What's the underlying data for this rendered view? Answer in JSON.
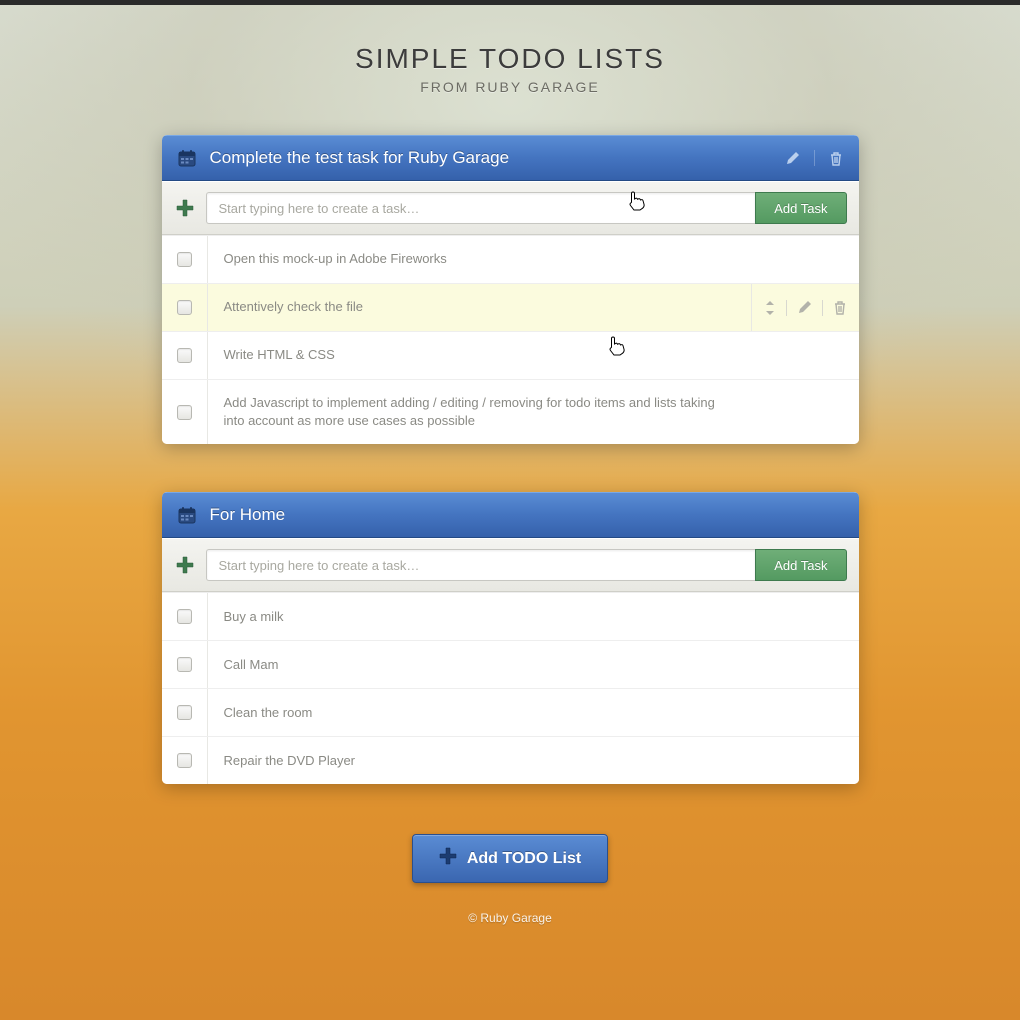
{
  "header": {
    "title": "SIMPLE TODO LISTS",
    "subtitle": "FROM RUBY GARAGE"
  },
  "add_task_button": "Add Task",
  "task_placeholder": "Start typing here to create a task…",
  "lists": [
    {
      "title": "Complete the test task for Ruby Garage",
      "show_header_actions": true,
      "tasks": [
        {
          "text": "Open this mock-up in Adobe Fireworks",
          "highlighted": false,
          "show_actions": false
        },
        {
          "text": "Attentively check the file",
          "highlighted": true,
          "show_actions": true
        },
        {
          "text": "Write HTML & CSS",
          "highlighted": false,
          "show_actions": false
        },
        {
          "text": "Add Javascript to implement adding / editing / removing for todo items and lists taking into account as more use cases as possible",
          "highlighted": false,
          "show_actions": false
        }
      ]
    },
    {
      "title": "For Home",
      "show_header_actions": false,
      "tasks": [
        {
          "text": "Buy a milk",
          "highlighted": false,
          "show_actions": false
        },
        {
          "text": "Call Mam",
          "highlighted": false,
          "show_actions": false
        },
        {
          "text": "Clean the room",
          "highlighted": false,
          "show_actions": false
        },
        {
          "text": "Repair the DVD Player",
          "highlighted": false,
          "show_actions": false
        }
      ]
    }
  ],
  "add_list_button": "Add TODO List",
  "footer": "© Ruby Garage"
}
